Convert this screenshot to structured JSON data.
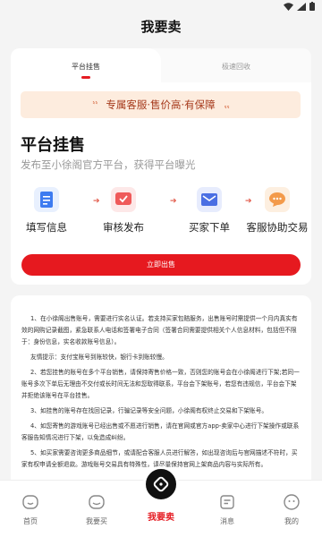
{
  "page_title": "我要卖",
  "tabs": [
    {
      "label": "平台挂售",
      "active": true
    },
    {
      "label": "极速回收",
      "active": false
    }
  ],
  "banner": {
    "text": "专属客服·售价高·有保障"
  },
  "sale": {
    "title": "平台挂售",
    "subtitle": "发布至小徐阁官方平台，获得平台曝光"
  },
  "steps": [
    {
      "label": "填写信息",
      "icon": "document-icon",
      "color": "#3d7bf0"
    },
    {
      "label": "审核发布",
      "icon": "review-icon",
      "color": "#ef5a5a"
    },
    {
      "label": "买家下单",
      "icon": "mail-icon",
      "color": "#4a6fe3"
    },
    {
      "label": "客服协助交易",
      "icon": "chat-icon",
      "color": "#f39a4a"
    }
  ],
  "sell_button": "立即出售",
  "notes": [
    "1、在小徐阁出售账号，需要进行实名认证。若支持买家包赔服务，出售账号时需提供一个月内真实有效的网购记录截图，紧急联系人电话和签署电子合同（签署合同需要提供相关个人信息材料，包括但不限于：身份信息，实名收款账号信息）。",
    "友情提示：支付宝账号到账较快，银行卡到账较慢。",
    "2、若您挂售的账号在多个平台销售，请保持寄售价格一致，否则您的账号会在小徐阁进行下架;若同一账号多次下单后无理由不交付或长时间无法和您取得联系，平台会下架账号，若您有违规信，平台会下架并拒绝该账号在平台挂售。",
    "3、如挂售的账号存在找回记录，行骗记录等安全问题，小徐阁有权终止交易和下架账号。",
    "4、如您寄售的游戏账号已经出售或不愿进行销售，请在官网或官方app-卖家中心进行下架操作或联系客服告知情况进行下架，以免造成纠纷。",
    "5、如买家需要咨询更多商品细节，或请配合客服人员进行解答，如出现咨询后与官网描述不符时，买家有权申请全额退款。游戏账号交易具有特殊性，请尽量保持官网上架商品内容与实际所有。"
  ],
  "tabbar": [
    {
      "label": "首页",
      "icon": "home-icon"
    },
    {
      "label": "我要买",
      "icon": "buy-icon"
    },
    {
      "label": "我要卖",
      "icon": "sell-icon",
      "active": true
    },
    {
      "label": "消息",
      "icon": "message-icon"
    },
    {
      "label": "我的",
      "icon": "profile-icon"
    }
  ],
  "colors": {
    "accent": "#e6191f",
    "banner_bg": "#fdecde",
    "banner_text": "#a63a1c"
  }
}
